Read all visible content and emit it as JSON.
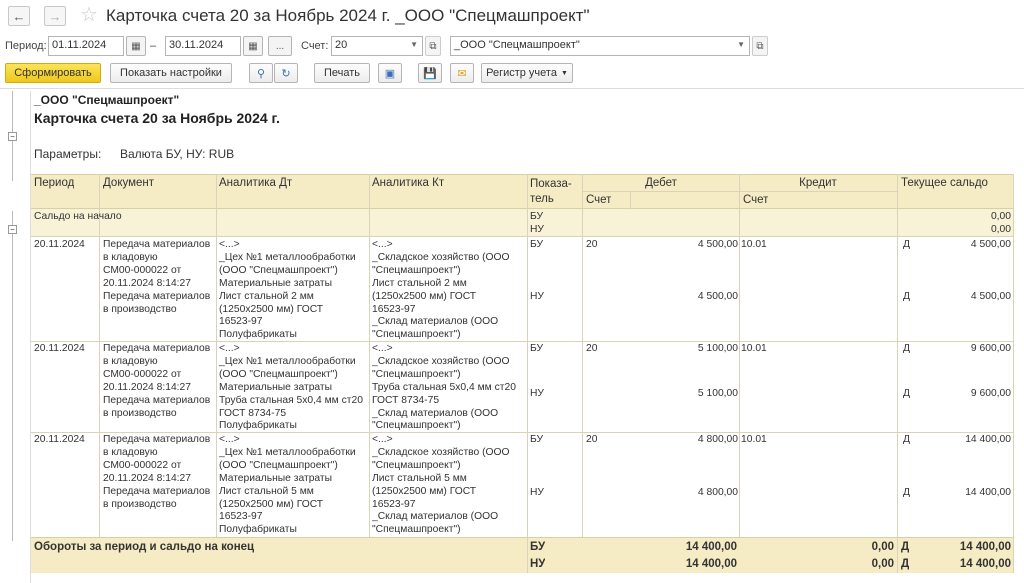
{
  "window": {
    "title": "Карточка счета 20 за Ноябрь 2024 г. _ООО \"Спецмашпроект\""
  },
  "filters": {
    "period_label": "Период:",
    "date_from": "01.11.2024",
    "dash": "–",
    "date_to": "30.11.2024",
    "more": "...",
    "account_label": "Счет:",
    "account": "20",
    "organization": "_ООО \"Спецмашпроект\""
  },
  "toolbar": {
    "generate": "Сформировать",
    "show_settings": "Показать настройки",
    "print": "Печать",
    "register": "Регистр учета"
  },
  "report": {
    "org": "_ООО \"Спецмашпроект\"",
    "title": "Карточка счета 20 за Ноябрь 2024 г.",
    "params_label": "Параметры:",
    "params_value": "Валюта БУ, НУ: RUB",
    "columns": {
      "period": "Период",
      "document": "Документ",
      "analytics_dt": "Аналитика Дт",
      "analytics_kt": "Аналитика Кт",
      "indicator": "Показа-\nтель",
      "debit": "Дебет",
      "debit_account": "Счет",
      "credit": "Кредит",
      "credit_account": "Счет",
      "balance": "Текущее сальдо"
    },
    "opening": {
      "label": "Сальдо на начало",
      "ind_bu": "БУ",
      "ind_nu": "НУ",
      "bal_bu": "0,00",
      "bal_nu": "0,00"
    },
    "rows": [
      {
        "period": "20.11.2024",
        "doc1": "Передача материалов\nв кладовую\nСМ00-000022 от\n20.11.2024 8:14:27",
        "doc2": "Передача материалов\nв производство",
        "dt": "<...>\n_Цех №1 металлообработки\n(ООО \"Спецмашпроект\")\nМатериальные затраты\nЛист стальной 2 мм\n(1250x2500 мм) ГОСТ\n16523-97\nПолуфабрикаты",
        "kt": "<...>\n_Складское хозяйство (ООО\n\"Спецмашпроект\")\nЛист стальной 2 мм\n(1250x2500 мм) ГОСТ\n16523-97\n_Склад материалов (ООО\n\"Спецмашпроект\")",
        "ind_bu": "БУ",
        "ind_nu": "НУ",
        "dacc": "20",
        "debit_bu": "4 500,00",
        "debit_nu": "4 500,00",
        "cacc": "10.01",
        "bal_dir_bu": "Д",
        "bal_bu": "4 500,00",
        "bal_dir_nu": "Д",
        "bal_nu": "4 500,00"
      },
      {
        "period": "20.11.2024",
        "doc1": "Передача материалов\nв кладовую\nСМ00-000022 от\n20.11.2024 8:14:27",
        "doc2": "Передача материалов\nв производство",
        "dt": "<...>\n_Цех №1 металлообработки\n(ООО \"Спецмашпроект\")\nМатериальные затраты\nТруба стальная 5x0,4 мм ст20\nГОСТ 8734-75\nПолуфабрикаты",
        "kt": "<...>\n_Складское хозяйство (ООО\n\"Спецмашпроект\")\nТруба стальная 5x0,4 мм ст20\nГОСТ 8734-75\n_Склад материалов (ООО\n\"Спецмашпроект\")",
        "ind_bu": "БУ",
        "ind_nu": "НУ",
        "dacc": "20",
        "debit_bu": "5 100,00",
        "debit_nu": "5 100,00",
        "cacc": "10.01",
        "bal_dir_bu": "Д",
        "bal_bu": "9 600,00",
        "bal_dir_nu": "Д",
        "bal_nu": "9 600,00"
      },
      {
        "period": "20.11.2024",
        "doc1": "Передача материалов\nв кладовую\nСМ00-000022 от\n20.11.2024 8:14:27",
        "doc2": "Передача материалов\nв производство",
        "dt": "<...>\n_Цех №1 металлообработки\n(ООО \"Спецмашпроект\")\nМатериальные затраты\nЛист стальной 5 мм\n(1250x2500 мм) ГОСТ\n16523-97\nПолуфабрикаты",
        "kt": "<...>\n_Складское хозяйство (ООО\n\"Спецмашпроект\")\nЛист стальной 5 мм\n(1250x2500 мм) ГОСТ\n16523-97\n_Склад материалов (ООО\n\"Спецмашпроект\")",
        "ind_bu": "БУ",
        "ind_nu": "НУ",
        "dacc": "20",
        "debit_bu": "4 800,00",
        "debit_nu": "4 800,00",
        "cacc": "10.01",
        "bal_dir_bu": "Д",
        "bal_bu": "14 400,00",
        "bal_dir_nu": "Д",
        "bal_nu": "14 400,00"
      }
    ],
    "totals": {
      "label": "Обороты за период и сальдо на конец",
      "ind_bu": "БУ",
      "ind_nu": "НУ",
      "debit_bu": "14 400,00",
      "debit_nu": "14 400,00",
      "credit_bu": "0,00",
      "credit_nu": "0,00",
      "bal_dir_bu": "Д",
      "bal_bu": "14 400,00",
      "bal_dir_nu": "Д",
      "bal_nu": "14 400,00"
    }
  }
}
